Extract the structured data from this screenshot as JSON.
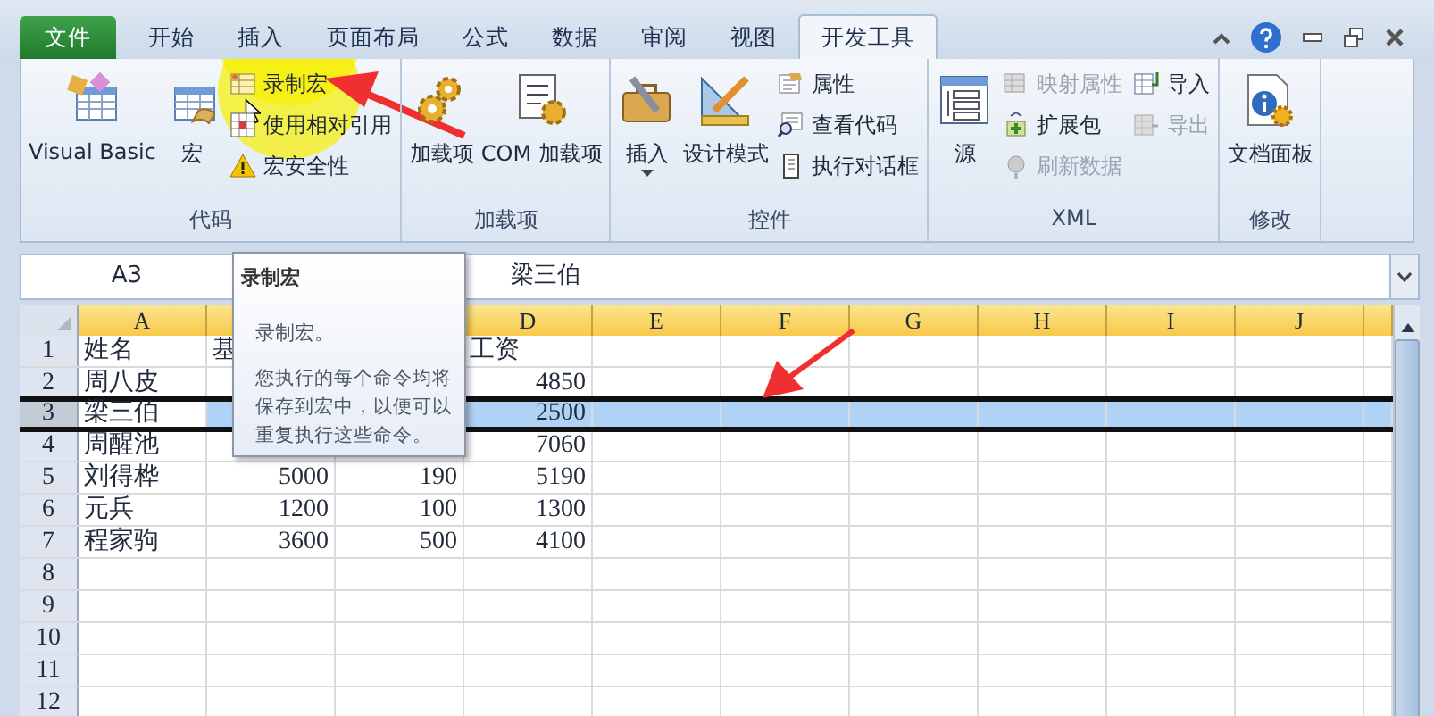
{
  "tabs": [
    {
      "label": "文件",
      "kind": "file",
      "selected": false
    },
    {
      "label": "开始",
      "kind": "tab",
      "selected": false
    },
    {
      "label": "插入",
      "kind": "tab",
      "selected": false
    },
    {
      "label": "页面布局",
      "kind": "tab",
      "selected": false
    },
    {
      "label": "公式",
      "kind": "tab",
      "selected": false
    },
    {
      "label": "数据",
      "kind": "tab",
      "selected": false
    },
    {
      "label": "审阅",
      "kind": "tab",
      "selected": false
    },
    {
      "label": "视图",
      "kind": "tab",
      "selected": false
    },
    {
      "label": "开发工具",
      "kind": "tab",
      "selected": true
    }
  ],
  "groups": [
    {
      "label": "代码",
      "items": [
        {
          "kind": "large",
          "label": "Visual Basic"
        },
        {
          "kind": "large",
          "label": "宏"
        },
        {
          "kind": "stack",
          "items": [
            {
              "label": "录制宏",
              "disabled": false
            },
            {
              "label": "使用相对引用",
              "disabled": false
            },
            {
              "label": "宏安全性",
              "disabled": false
            }
          ]
        }
      ]
    },
    {
      "label": "加载项",
      "items": [
        {
          "kind": "large",
          "label": "加载项"
        },
        {
          "kind": "large",
          "label": "COM 加载项"
        }
      ]
    },
    {
      "label": "控件",
      "items": [
        {
          "kind": "large",
          "label": "插入",
          "dropdown": true
        },
        {
          "kind": "large",
          "label": "设计模式"
        },
        {
          "kind": "stack",
          "items": [
            {
              "label": "属性",
              "disabled": false
            },
            {
              "label": "查看代码",
              "disabled": false
            },
            {
              "label": "执行对话框",
              "disabled": false
            }
          ]
        }
      ]
    },
    {
      "label": "XML",
      "items": [
        {
          "kind": "large",
          "label": "源"
        },
        {
          "kind": "stack",
          "items": [
            {
              "label": "映射属性",
              "disabled": true
            },
            {
              "label": "扩展包",
              "disabled": false
            },
            {
              "label": "刷新数据",
              "disabled": true
            }
          ]
        },
        {
          "kind": "stack",
          "items": [
            {
              "label": "导入",
              "disabled": false
            },
            {
              "label": "导出",
              "disabled": true
            }
          ]
        }
      ]
    },
    {
      "label": "修改",
      "items": [
        {
          "kind": "large",
          "label": "文档面板"
        }
      ]
    }
  ],
  "formula_bar": {
    "name_box": "A3",
    "value": "梁三伯"
  },
  "columns": [
    {
      "label": "A"
    },
    {},
    {},
    {
      "label": "D"
    },
    {
      "label": "E"
    },
    {
      "label": "F"
    },
    {
      "label": "G"
    },
    {
      "label": "H"
    },
    {
      "label": "I"
    },
    {
      "label": "J"
    }
  ],
  "rows": [
    {
      "number": "1",
      "selected": false,
      "cells": [
        {
          "text": "姓名",
          "kind": "text"
        },
        {
          "text": "基",
          "kind": "text"
        },
        {},
        {
          "text": "工资",
          "kind": "text"
        }
      ]
    },
    {
      "number": "2",
      "selected": false,
      "cells": [
        {
          "text": "周八皮",
          "kind": "text"
        },
        {},
        {},
        {
          "text": "4850",
          "kind": "number"
        }
      ]
    },
    {
      "number": "3",
      "selected": true,
      "cells": [
        {
          "text": "梁三伯",
          "kind": "text"
        },
        {},
        {},
        {
          "text": "2500",
          "kind": "number"
        }
      ]
    },
    {
      "number": "4",
      "selected": false,
      "cells": [
        {
          "text": "周醒池",
          "kind": "text"
        },
        {},
        {},
        {
          "text": "7060",
          "kind": "number"
        }
      ]
    },
    {
      "number": "5",
      "selected": false,
      "cells": [
        {
          "text": "刘得桦",
          "kind": "text"
        },
        {
          "text": "5000",
          "kind": "number"
        },
        {
          "text": "190",
          "kind": "number"
        },
        {
          "text": "5190",
          "kind": "number"
        }
      ]
    },
    {
      "number": "6",
      "selected": false,
      "cells": [
        {
          "text": "元兵",
          "kind": "text"
        },
        {
          "text": "1200",
          "kind": "number"
        },
        {
          "text": "100",
          "kind": "number"
        },
        {
          "text": "1300",
          "kind": "number"
        }
      ]
    },
    {
      "number": "7",
      "selected": false,
      "cells": [
        {
          "text": "程家驹",
          "kind": "text"
        },
        {
          "text": "3600",
          "kind": "number"
        },
        {
          "text": "500",
          "kind": "number"
        },
        {
          "text": "4100",
          "kind": "number"
        }
      ]
    },
    {
      "number": "8",
      "selected": false,
      "cells": []
    },
    {
      "number": "9",
      "selected": false,
      "cells": []
    },
    {
      "number": "10",
      "selected": false,
      "cells": []
    },
    {
      "number": "11",
      "selected": false,
      "cells": []
    },
    {
      "number": "12",
      "selected": false,
      "cells": []
    }
  ],
  "tooltip": {
    "title": "录制宏",
    "text": "录制宏。",
    "description": "您执行的每个命令均将保存到宏中，以便可以重复执行这些命令。"
  },
  "annotations": [
    {
      "kind": "highlight"
    },
    {
      "kind": "cursor"
    },
    {
      "kind": "arrow"
    },
    {
      "kind": "arrow"
    }
  ]
}
